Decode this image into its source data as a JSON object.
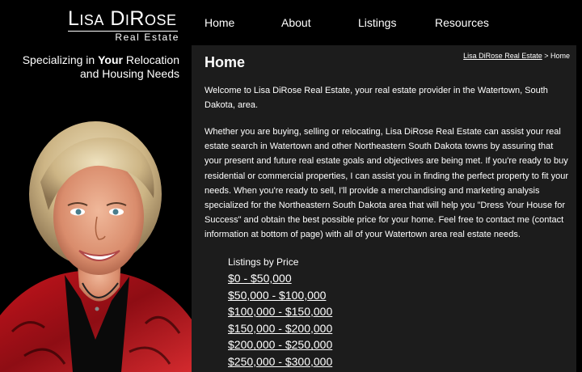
{
  "logo": {
    "name": "Lisa DiRose",
    "subtitle": "Real Estate"
  },
  "nav": {
    "items": [
      {
        "label": "Home"
      },
      {
        "label": "About"
      },
      {
        "label": "Listings"
      },
      {
        "label": "Resources"
      }
    ]
  },
  "tagline": {
    "prefix": "Specializing in ",
    "emphasis": "Your",
    "suffix": " Relocation",
    "line2": "and Housing Needs"
  },
  "main": {
    "title": "Home",
    "breadcrumb": {
      "link": "Lisa DiRose Real Estate",
      "separator": " > ",
      "current": "Home"
    },
    "paragraphs": [
      "Welcome to Lisa DiRose Real Estate, your real estate provider in the Watertown, South Dakota, area.",
      "Whether you are buying, selling or relocating, Lisa DiRose Real Estate can assist your real estate search in Watertown and other Northeastern South Dakota towns by assuring that your present and future real estate goals and objectives are being met. If you're ready to buy residential or commercial properties, I can assist you in finding the perfect property to fit your needs. When you're ready to sell, I'll provide a merchandising and marketing analysis specialized for the Northeastern South Dakota area that will help you \"Dress Your House for Success\" and obtain the best possible price for your home. Feel free to contact me (contact information at bottom of page) with all of your Watertown area real estate needs."
    ],
    "listings": {
      "title": "Listings by Price",
      "ranges": [
        "$0 - $50,000",
        "$50,000 - $100,000",
        "$100,000 - $150,000",
        "$150,000 - $200,000",
        "$200,000 - $250,000",
        "$250,000 - $300,000"
      ]
    }
  },
  "colors": {
    "background": "#000000",
    "panel": "#1c1c1c",
    "text": "#ffffff",
    "blouse": "#b3121a"
  }
}
